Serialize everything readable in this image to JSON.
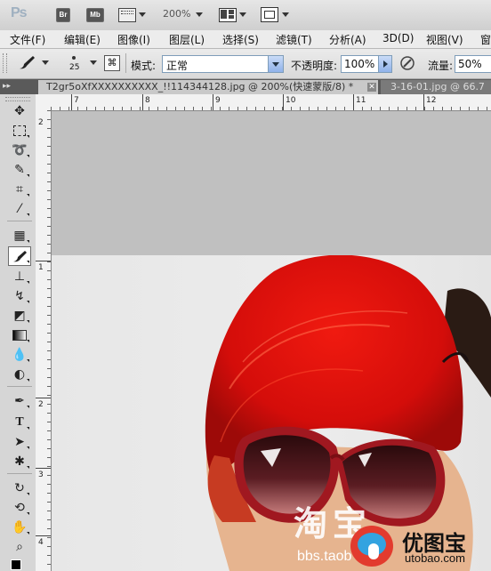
{
  "app": {
    "logo": "Ps",
    "bridge_btn": "Br",
    "minibridge_btn": "Mb",
    "zoom_level": "200%"
  },
  "menu": [
    "文件(F)",
    "编辑(E)",
    "图像(I)",
    "图层(L)",
    "选择(S)",
    "滤镜(T)",
    "分析(A)",
    "3D(D)",
    "视图(V)",
    "窗"
  ],
  "options": {
    "brush_size": "25",
    "mode_label": "模式:",
    "mode_value": "正常",
    "opacity_label": "不透明度:",
    "opacity_value": "100%",
    "flow_label": "流量:",
    "flow_value": "50%"
  },
  "tabs": [
    {
      "label": "T2gr5oXfXXXXXXXXXX_!!114344128.jpg @ 200%(快速蒙版/8) *",
      "active": true
    },
    {
      "label": "3-16-01.jpg @ 66.7",
      "active": false
    }
  ],
  "ruler_top": [
    "7",
    "8",
    "9",
    "10",
    "11",
    "12"
  ],
  "ruler_left": [
    "2",
    "1",
    "2",
    "3",
    "4"
  ],
  "watermarks": {
    "taobao_cn": "淘宝",
    "taobao_url": "bbs.taob",
    "utobao_cn": "优图宝",
    "utobao_url": "utobao.com"
  },
  "colors": {
    "mask_red": "#e01010",
    "canvas_gray": "#c0c0c0",
    "tab_bar": "#5a5a5a"
  }
}
